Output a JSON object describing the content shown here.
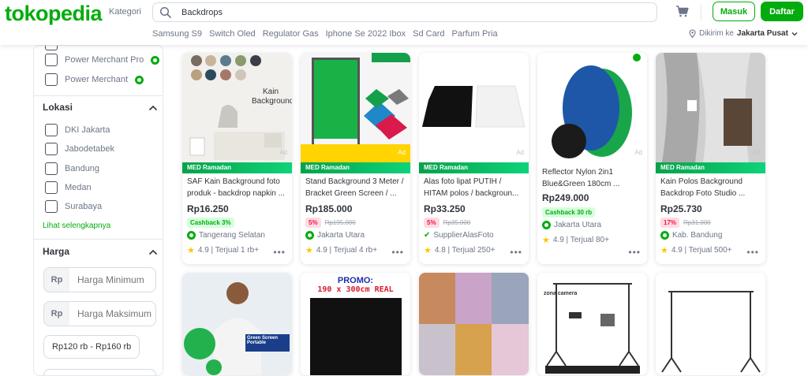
{
  "header": {
    "logo": "tokopedia",
    "kategori": "Kategori",
    "search_value": "Backdrops",
    "login_label": "Masuk",
    "register_label": "Daftar",
    "keywords": [
      "Samsung S9",
      "Switch Oled",
      "Regulator Gas",
      "Iphone Se 2022 Ibox",
      "Sd Card",
      "Parfum Pria"
    ],
    "location_prefix": "Dikirim ke",
    "location_value": "Jakarta Pusat"
  },
  "sidebar": {
    "merchant_options": [
      "Power Merchant Pro",
      "Power Merchant"
    ],
    "lokasi_title": "Lokasi",
    "locations": [
      "DKI Jakarta",
      "Jabodetabek",
      "Bandung",
      "Medan",
      "Surabaya"
    ],
    "see_more": "Lihat selengkapnya",
    "harga_title": "Harga",
    "rp_label": "Rp",
    "min_placeholder": "Harga Minimum",
    "max_placeholder": "Harga Maksimum",
    "range_chip": "Rp120 rb - Rp160 rb"
  },
  "products": [
    {
      "label": "MED Ramadan",
      "name": "SAF Kain Background foto produk - backdrop napkin ...",
      "price": "Rp16.250",
      "cashback": "Cashback 3%",
      "shop": "Tangerang Selatan",
      "rating": "4.9 | Terjual 1 rb+",
      "ad": "Ad",
      "img_text": "Kain Background"
    },
    {
      "label": "MED Ramadan",
      "name": "Stand Background 3 Meter / Bracket Green Screen / ...",
      "price": "Rp185.000",
      "discount": "5%",
      "old_price": "Rp195.000",
      "shop": "Jakarta Utara",
      "rating": "4.9 | Terjual 4 rb+",
      "ad": "Ad"
    },
    {
      "label": "MED Ramadan",
      "name": "Alas foto lipat PUTIH / HITAM polos / backgroun...",
      "price": "Rp33.250",
      "discount": "5%",
      "old_price": "Rp35.000",
      "shop": "SupplierAlasFoto",
      "rating": "4.8 | Terjual 250+",
      "ad": "Ad"
    },
    {
      "name": "Reflector Nylon 2in1 Blue&Green 180cm ...",
      "price": "Rp249.000",
      "cashback": "Cashback 30 rb",
      "shop": "Jakarta Utara",
      "rating": "4.9 | Terjual 80+",
      "ad": "Ad"
    },
    {
      "label": "MED Ramadan",
      "name": "Kain Polos Background Backdrop Foto Studio ...",
      "price": "Rp25.730",
      "discount": "17%",
      "old_price": "Rp31.000",
      "shop": "Kab. Bandung",
      "rating": "4.9 | Terjual 500+",
      "ad": "Ad"
    }
  ],
  "row2": {
    "promo_line1": "PROMO:",
    "promo_line2": "190 x 300cm REAL",
    "green_screen": "Green Screen Portable",
    "zona_camera": "zona camera"
  },
  "colors": {
    "brand": "#03AC0E",
    "text": "#31353B",
    "muted": "#6D7588"
  }
}
